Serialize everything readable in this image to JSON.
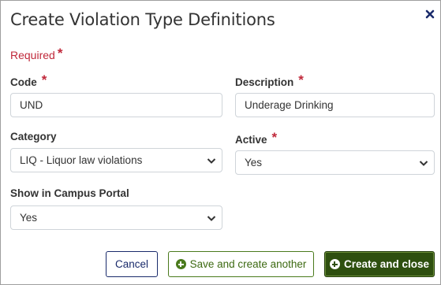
{
  "dialog": {
    "title": "Create Violation Type Definitions",
    "close_icon": "close-x-icon",
    "required_label": "Required",
    "required_marker": "*"
  },
  "form": {
    "code": {
      "label": "Code",
      "value": "UND",
      "required": true
    },
    "description": {
      "label": "Description",
      "value": "Underage Drinking",
      "required": true
    },
    "category": {
      "label": "Category",
      "selected": "LIQ - Liquor law violations",
      "required": false
    },
    "active": {
      "label": "Active",
      "selected": "Yes",
      "required": true
    },
    "campus_portal": {
      "label": "Show in Campus Portal",
      "selected": "Yes",
      "required": false
    }
  },
  "buttons": {
    "cancel": "Cancel",
    "save_another": "Save and create another",
    "create_close": "Create and close"
  },
  "colors": {
    "required": "#c0283a",
    "navy": "#1a2b6b",
    "green": "#4a7a1c",
    "dark_green": "#2e4f0f"
  }
}
